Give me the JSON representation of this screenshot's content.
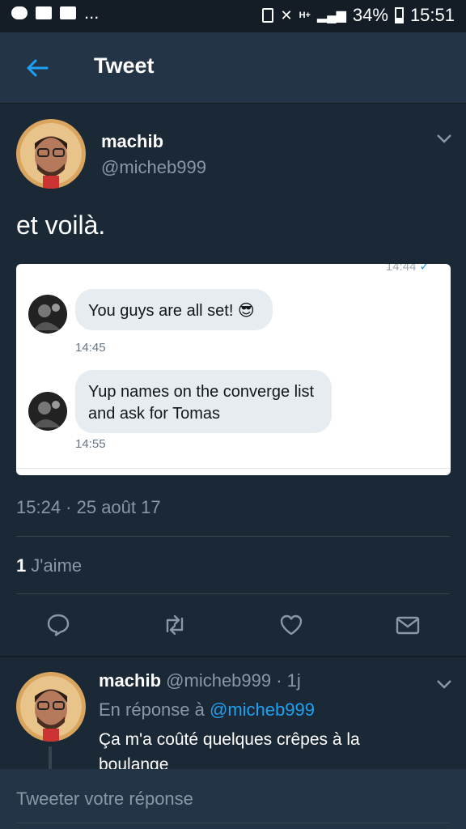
{
  "status_bar": {
    "notification_icons": [
      "cloud-icon",
      "image-icon",
      "calendar-icon"
    ],
    "more": "...",
    "battery": "34%",
    "battery_level": 0.34,
    "time": "15:51",
    "network": "H+"
  },
  "header": {
    "title": "Tweet"
  },
  "tweet": {
    "author_name": "machib",
    "author_handle": "@micheb999",
    "text": "et voilà.",
    "media": {
      "top_time": "14:44",
      "messages": [
        {
          "text": "You guys are all set! 😎",
          "time": "14:45"
        },
        {
          "line1": "Yup names on the converge list",
          "line2": "and ask for Tomas",
          "time": "14:55"
        }
      ]
    },
    "timestamp": "15:24 · 25 août 17",
    "likes_count": "1",
    "likes_label": "J'aime"
  },
  "reply": {
    "author_name": "machib",
    "meta": "@micheb999 · 1j",
    "in_reply_prefix": "En réponse à",
    "in_reply_handle": "@micheb999",
    "line1": "Ça m'a coûté quelques crêpes à la",
    "line2": "boulange"
  },
  "composer": {
    "placeholder": "Tweeter votre réponse"
  },
  "colors": {
    "background": "#1b2836",
    "bar": "#243447",
    "accent": "#1da1f2",
    "muted": "#8899a6"
  }
}
